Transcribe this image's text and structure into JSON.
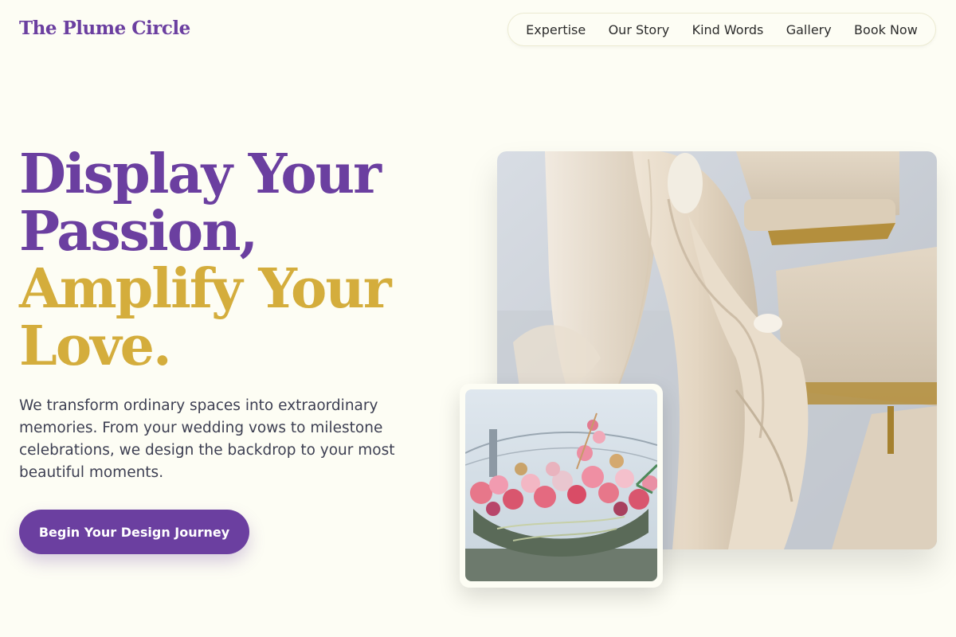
{
  "brand": {
    "name": "The Plume Circle"
  },
  "nav": {
    "items": [
      {
        "label": "Expertise"
      },
      {
        "label": "Our Story"
      },
      {
        "label": "Kind Words"
      },
      {
        "label": "Gallery"
      },
      {
        "label": "Book Now"
      }
    ]
  },
  "hero": {
    "headline_line1": "Display Your",
    "headline_line2": "Passion,",
    "headline_line3": "Amplify Your",
    "headline_line4": "Love.",
    "description": "We transform ordinary spaces into extraordinary memories. From your wedding vows to milestone celebrations, we design the backdrop to your most beautiful moments.",
    "cta_label": "Begin Your Design Journey"
  },
  "colors": {
    "background": "#fdfdf4",
    "brand_purple": "#6b3fa0",
    "accent_gold": "#d4ad3c",
    "body_text": "#3d3f52"
  },
  "images": {
    "main": {
      "subject": "draped ivory fabric tied over chair backs"
    },
    "inset": {
      "subject": "hanging floral installation with pink flowers"
    }
  }
}
